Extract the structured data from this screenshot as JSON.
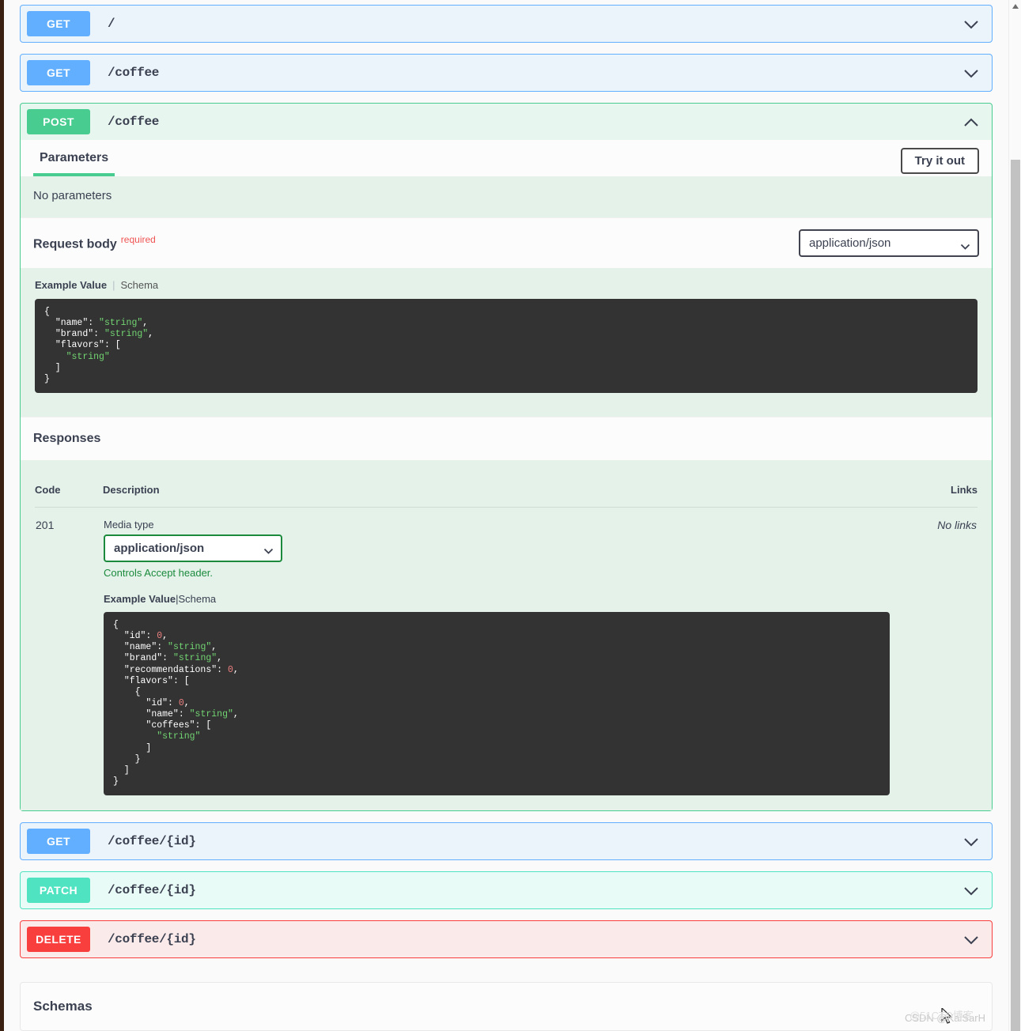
{
  "operations": [
    {
      "verb": "GET",
      "path": "/",
      "expanded": false,
      "style": "get"
    },
    {
      "verb": "GET",
      "path": "/coffee",
      "expanded": false,
      "style": "get"
    },
    {
      "verb": "POST",
      "path": "/coffee",
      "expanded": true,
      "style": "post"
    },
    {
      "verb": "GET",
      "path": "/coffee/{id}",
      "expanded": false,
      "style": "get"
    },
    {
      "verb": "PATCH",
      "path": "/coffee/{id}",
      "expanded": false,
      "style": "patch"
    },
    {
      "verb": "DELETE",
      "path": "/coffee/{id}",
      "expanded": false,
      "style": "delete"
    }
  ],
  "post_detail": {
    "parameters_tab": "Parameters",
    "try_it_out": "Try it out",
    "no_parameters": "No parameters",
    "request_body_label": "Request body",
    "required_flag": "required",
    "request_media_type": "application/json",
    "example_value_tab": "Example Value",
    "schema_tab": "Schema",
    "request_example": "{\n  \"name\": \"string\",\n  \"brand\": \"string\",\n  \"flavors\": [\n    \"string\"\n  ]\n}",
    "responses_title": "Responses",
    "table_headers": {
      "code": "Code",
      "description": "Description",
      "links": "Links"
    },
    "response_rows": [
      {
        "code": "201",
        "no_links": "No links",
        "media_type_label": "Media type",
        "media_type_value": "application/json",
        "accept_note": "Controls Accept header.",
        "example_value_tab": "Example Value",
        "schema_tab": "Schema",
        "example": "{\n  \"id\": 0,\n  \"name\": \"string\",\n  \"brand\": \"string\",\n  \"recommendations\": 0,\n  \"flavors\": [\n    {\n      \"id\": 0,\n      \"name\": \"string\",\n      \"coffees\": [\n        \"string\"\n      ]\n    }\n  ]\n}"
      }
    ]
  },
  "schemas": {
    "title": "Schemas"
  },
  "watermark": {
    "primary": "CSDN @KaiSarH",
    "secondary": "@51CTO博客"
  },
  "colors": {
    "get": "#61affe",
    "post": "#49cc90",
    "patch": "#50e3c2",
    "delete": "#f93e3e",
    "required": "#f05454",
    "accept_note": "#1b8a3c",
    "code_bg": "#333333",
    "code_string": "#72d572",
    "code_number": "#f08080"
  }
}
